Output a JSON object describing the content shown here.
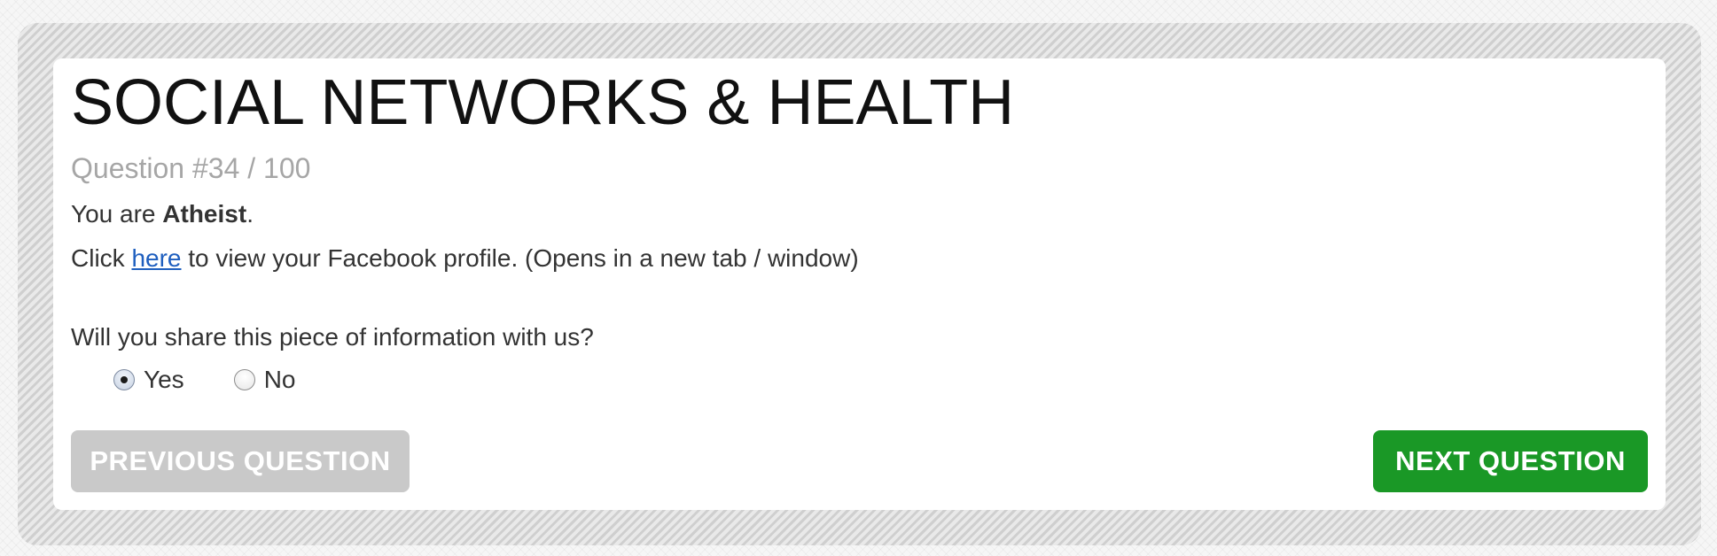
{
  "header": {
    "title": "SOCIAL NETWORKS & HEALTH",
    "question_counter": "Question #34 / 100"
  },
  "content": {
    "identity_prefix": "You are ",
    "identity_value": "Atheist",
    "identity_suffix": ".",
    "link_prefix": "Click ",
    "link_text": "here",
    "link_suffix": " to view your Facebook profile. (Opens in a new tab / window)",
    "question": "Will you share this piece of information with us?"
  },
  "options": [
    {
      "label": "Yes",
      "selected": true
    },
    {
      "label": "No",
      "selected": false
    }
  ],
  "buttons": {
    "previous": "PREVIOUS QUESTION",
    "next": "NEXT QUESTION"
  },
  "colors": {
    "next_button": "#1a9826",
    "previous_button_disabled": "#c9c9c9",
    "link": "#1f5fbf",
    "counter_text": "#a6a6a6"
  }
}
